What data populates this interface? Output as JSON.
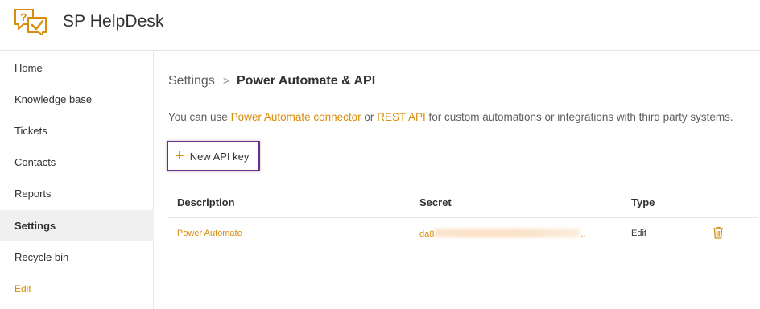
{
  "app": {
    "title": "SP HelpDesk",
    "logo_icon": "helpdesk-chat-check-logo",
    "accent": "#d88c0b"
  },
  "sidebar": {
    "items": [
      {
        "label": "Home"
      },
      {
        "label": "Knowledge base"
      },
      {
        "label": "Tickets"
      },
      {
        "label": "Contacts"
      },
      {
        "label": "Reports"
      },
      {
        "label": "Settings",
        "selected": true
      },
      {
        "label": "Recycle bin"
      }
    ],
    "edit_label": "Edit"
  },
  "breadcrumb": {
    "parent": "Settings",
    "separator": ">",
    "current": "Power Automate & API"
  },
  "intro": {
    "text_1": "You can use ",
    "link_1": "Power Automate connector",
    "text_2": " or ",
    "link_2": "REST API",
    "text_3": " for custom automations or integrations with third party systems."
  },
  "new_button": {
    "label": "New API key",
    "icon": "plus-icon"
  },
  "table": {
    "columns": [
      "Description",
      "Secret",
      "Type"
    ],
    "rows": [
      {
        "description": "Power Automate",
        "secret_prefix": "da8",
        "secret_suffix": "..",
        "type": "Edit",
        "action_icon": "trash-icon"
      }
    ]
  }
}
